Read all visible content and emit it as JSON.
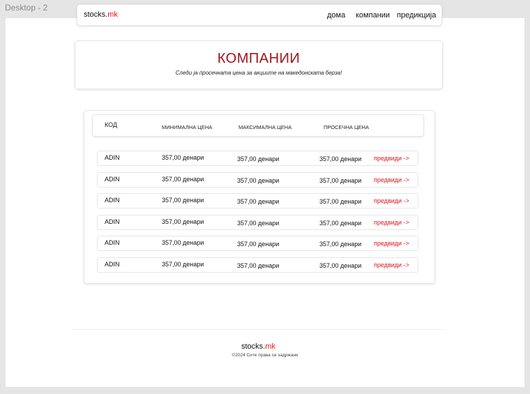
{
  "frame_label": "Desktop - 2",
  "brand": {
    "name": "stocks.",
    "suffix": "mk",
    "accent": "#e0161b"
  },
  "nav": {
    "home": "дома",
    "companies": "компании",
    "prediction": "предикција"
  },
  "hero": {
    "title": "КОМПАНИИ",
    "subtitle": "Следи ја просечната цена за акциите на македонската берза!"
  },
  "table": {
    "headers": {
      "code": "КОД",
      "min": "МИНИМАЛНА ЦЕНА",
      "max": "МАКСИМАЛНА ЦЕНА",
      "avg": "ПРОСЕЧНА ЦЕНА"
    },
    "rows": [
      {
        "code": "ADIN",
        "min": "357,00 денари",
        "max": "357,00 денари",
        "avg": "357,00 денари",
        "link": "предвиди ->"
      },
      {
        "code": "ADIN",
        "min": "357,00 денари",
        "max": "357,00 денари",
        "avg": "357,00 денари",
        "link": "предвиди ->"
      },
      {
        "code": "ADIN",
        "min": "357,00 денари",
        "max": "357,00 денари",
        "avg": "357,00 денари",
        "link": "предвиди ->"
      },
      {
        "code": "ADIN",
        "min": "357,00 денари",
        "max": "357,00 денари",
        "avg": "357,00 денари",
        "link": "предвиди ->"
      },
      {
        "code": "ADIN",
        "min": "357,00 денари",
        "max": "357,00 денари",
        "avg": "357,00 денари",
        "link": "предвиди ->"
      },
      {
        "code": "ADIN",
        "min": "357,00 денари",
        "max": "357,00 денари",
        "avg": "357,00 денари",
        "link": "предвиди ->"
      }
    ]
  },
  "footer": {
    "copyright": "©2024 Сите права се задржани"
  }
}
